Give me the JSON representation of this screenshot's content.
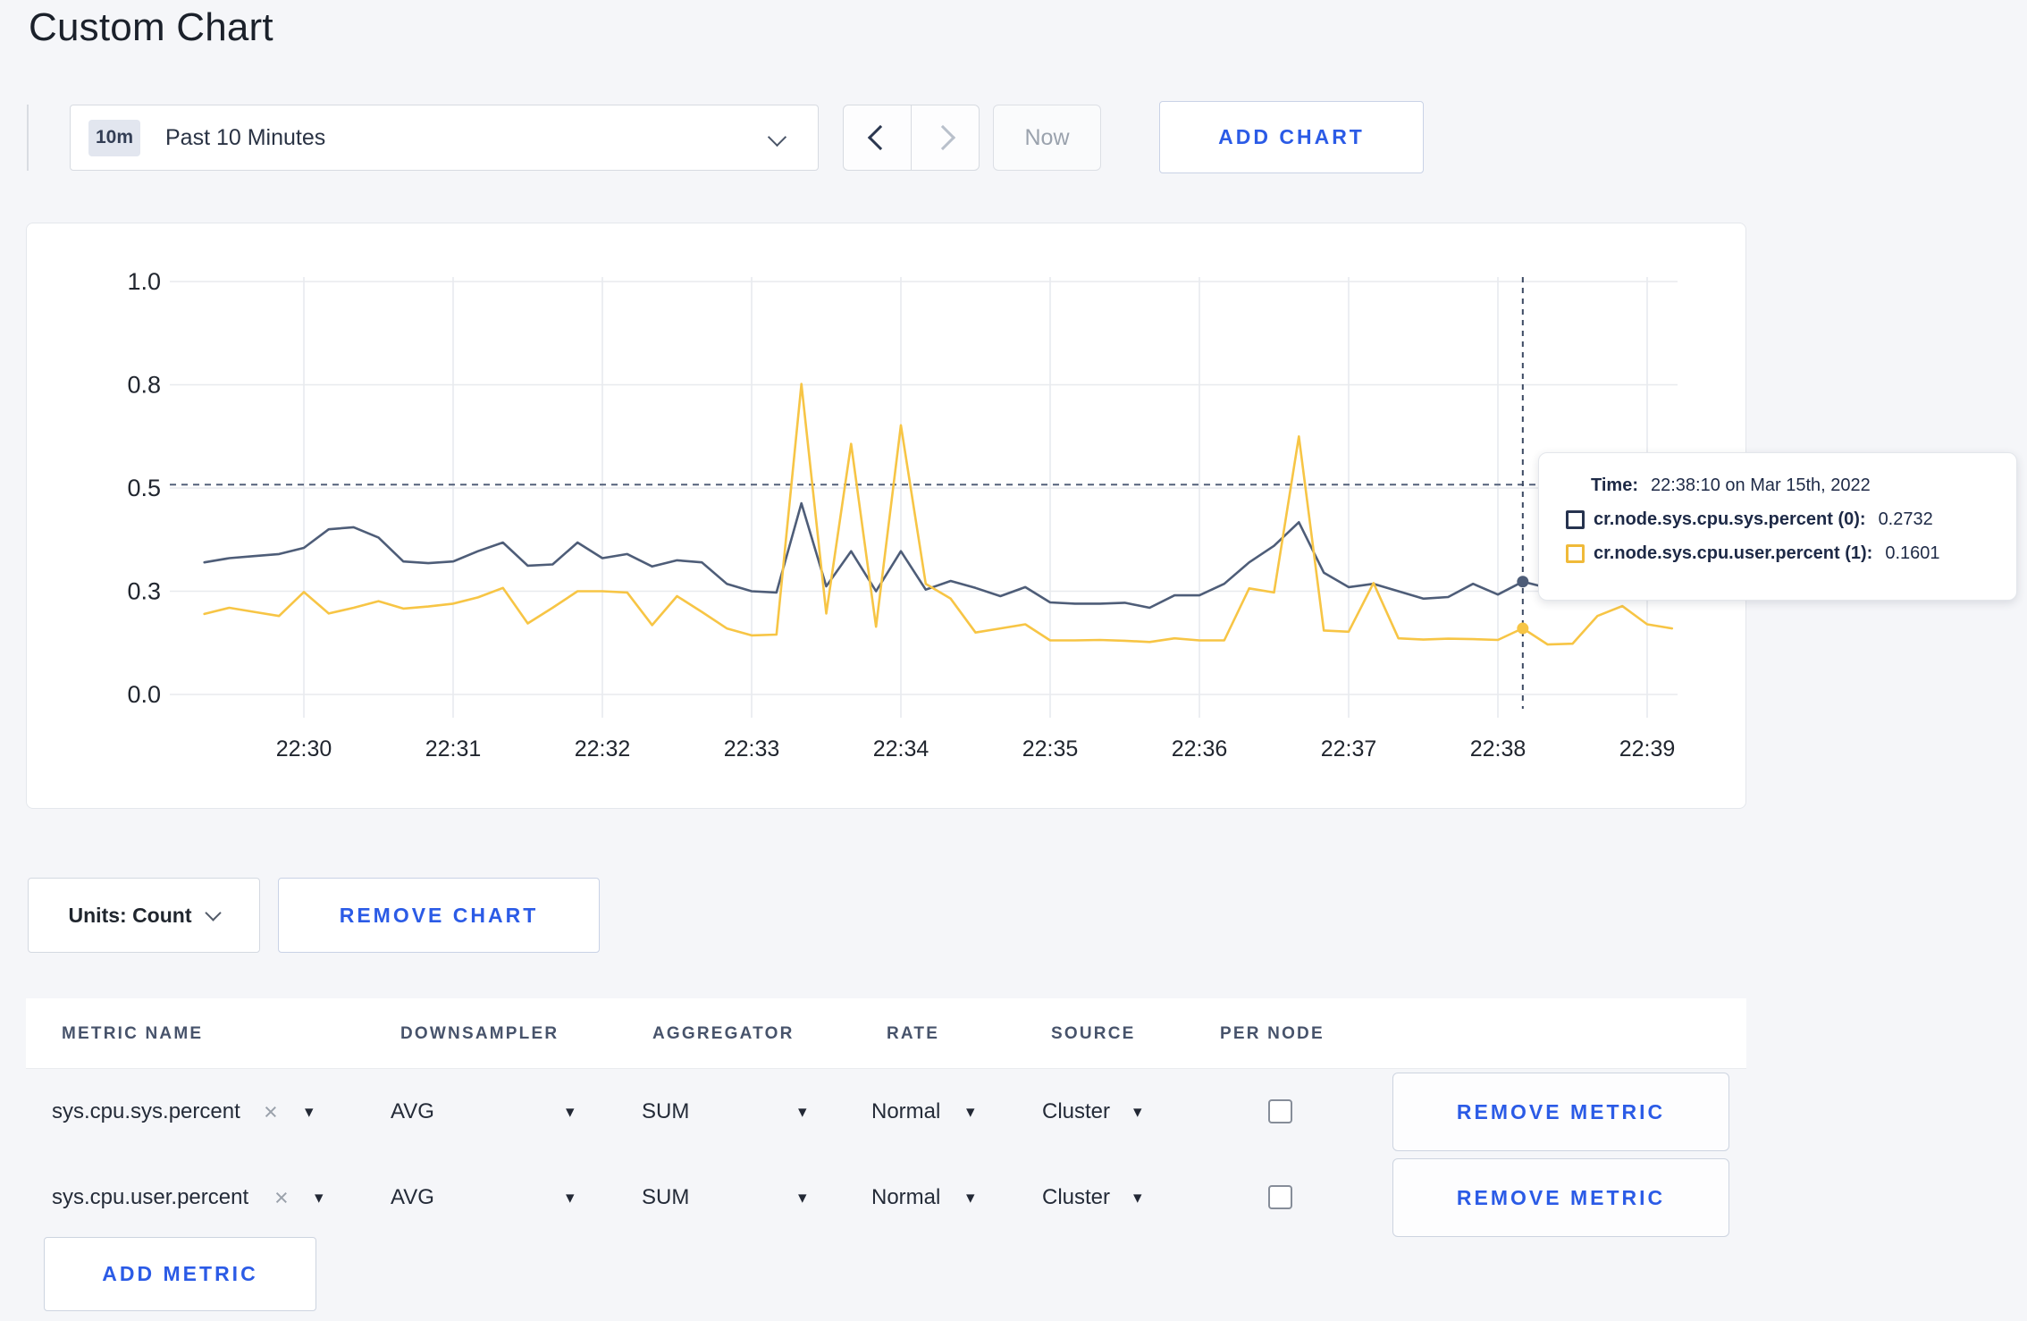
{
  "page": {
    "title": "Custom Chart"
  },
  "toolbar": {
    "range_badge": "10m",
    "range_label": "Past 10 Minutes",
    "now_label": "Now",
    "add_chart_label": "ADD CHART"
  },
  "chart_data": {
    "type": "line",
    "title": "",
    "xlabel": "",
    "ylabel": "",
    "ylim": [
      0,
      1
    ],
    "grid": true,
    "legend_position": "none",
    "x_start": "22:29:20",
    "x_step_seconds": 10,
    "x_tick_labels": [
      "22:30",
      "22:31",
      "22:32",
      "22:33",
      "22:34",
      "22:35",
      "22:36",
      "22:37",
      "22:38",
      "22:39"
    ],
    "y_ticks": [
      {
        "value": 0.0,
        "label": "0.0"
      },
      {
        "value": 0.25,
        "label": "0.3"
      },
      {
        "value": 0.5,
        "label": "0.5"
      },
      {
        "value": 0.75,
        "label": "0.8"
      },
      {
        "value": 1.0,
        "label": "1.0"
      }
    ],
    "colors": {
      "grid": "#e8eaee",
      "axis_text": "#21262f",
      "crosshair": "#54617a"
    },
    "series": [
      {
        "name": "cr.node.sys.cpu.sys.percent",
        "color": "#4e5d78",
        "values": [
          0.32,
          0.33,
          0.335,
          0.34,
          0.355,
          0.4,
          0.405,
          0.38,
          0.322,
          0.318,
          0.322,
          0.347,
          0.368,
          0.312,
          0.315,
          0.368,
          0.33,
          0.34,
          0.31,
          0.325,
          0.32,
          0.268,
          0.25,
          0.247,
          0.463,
          0.262,
          0.347,
          0.25,
          0.347,
          0.254,
          0.275,
          0.258,
          0.238,
          0.26,
          0.223,
          0.22,
          0.22,
          0.222,
          0.21,
          0.24,
          0.24,
          0.268,
          0.32,
          0.36,
          0.417,
          0.295,
          0.26,
          0.268,
          0.25,
          0.232,
          0.236,
          0.268,
          0.242,
          0.2732,
          0.258,
          0.262,
          0.27,
          0.276,
          0.27,
          0.28
        ]
      },
      {
        "name": "cr.node.sys.cpu.user.percent",
        "color": "#f7c545",
        "values": [
          0.195,
          0.21,
          0.2,
          0.19,
          0.248,
          0.196,
          0.21,
          0.226,
          0.208,
          0.213,
          0.22,
          0.235,
          0.258,
          0.172,
          0.21,
          0.25,
          0.25,
          0.247,
          0.168,
          0.238,
          0.2,
          0.16,
          0.143,
          0.145,
          0.752,
          0.196,
          0.607,
          0.164,
          0.652,
          0.268,
          0.232,
          0.15,
          0.16,
          0.17,
          0.131,
          0.131,
          0.132,
          0.13,
          0.127,
          0.136,
          0.131,
          0.131,
          0.257,
          0.247,
          0.625,
          0.155,
          0.152,
          0.27,
          0.136,
          0.133,
          0.135,
          0.134,
          0.132,
          0.1601,
          0.121,
          0.123,
          0.19,
          0.214,
          0.17,
          0.16
        ]
      }
    ],
    "crosshair": {
      "time": "22:38:10",
      "hline_value": 0.508,
      "points": [
        {
          "series_index": 0,
          "value": 0.2732
        },
        {
          "series_index": 1,
          "value": 0.1601
        }
      ]
    }
  },
  "tooltip": {
    "time_label": "Time:",
    "time_value": "22:38:10 on Mar 15th, 2022",
    "series": [
      {
        "label": "cr.node.sys.cpu.sys.percent (0):",
        "value": "0.2732",
        "swatch_color": "#26334f"
      },
      {
        "label": "cr.node.sys.cpu.user.percent (1):",
        "value": "0.1601",
        "swatch_color": "#f0ba39"
      }
    ]
  },
  "chart_footer": {
    "units_label": "Units: Count",
    "remove_chart_label": "REMOVE CHART"
  },
  "metrics_table": {
    "columns": [
      "METRIC NAME",
      "DOWNSAMPLER",
      "AGGREGATOR",
      "RATE",
      "SOURCE",
      "PER NODE"
    ],
    "rows": [
      {
        "metric": "sys.cpu.sys.percent",
        "remove_tag": "×",
        "downsampler": "AVG",
        "aggregator": "SUM",
        "rate": "Normal",
        "source": "Cluster",
        "per_node_checked": false,
        "remove_label": "REMOVE METRIC"
      },
      {
        "metric": "sys.cpu.user.percent",
        "remove_tag": "×",
        "downsampler": "AVG",
        "aggregator": "SUM",
        "rate": "Normal",
        "source": "Cluster",
        "per_node_checked": false,
        "remove_label": "REMOVE METRIC"
      }
    ],
    "add_metric_label": "ADD METRIC"
  }
}
